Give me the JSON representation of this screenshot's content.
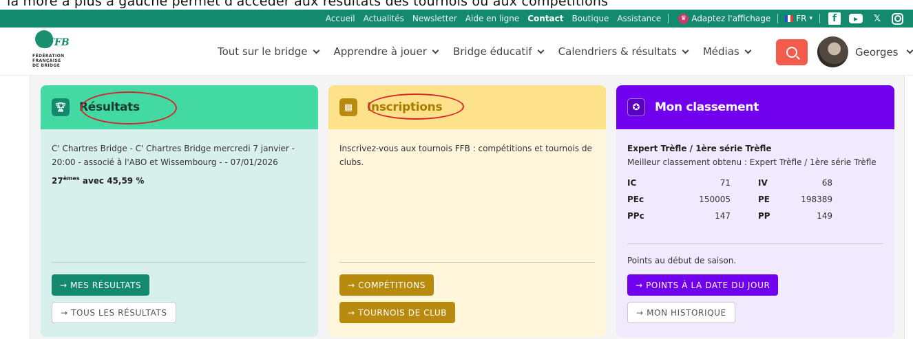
{
  "caption": "la more a plus a gauche permet d'acceder aux resultats des tournois ou aux competitions",
  "topbar": {
    "links": [
      "Accueil",
      "Actualités",
      "Newsletter",
      "Aide en ligne",
      "Contact",
      "Boutique",
      "Assistance"
    ],
    "adapt_label": "Adaptez l'affichage",
    "lang": "FR",
    "social": [
      "facebook-icon",
      "youtube-icon",
      "x-icon",
      "instagram-icon"
    ]
  },
  "logo": {
    "brand": "FFB",
    "line1": "FÉDÉRATION",
    "line2": "FRANÇAISE",
    "line3": "DE BRIDGE"
  },
  "nav": {
    "items": [
      "Tout sur le bridge",
      "Apprendre à jouer",
      "Bridge éducatif",
      "Calendriers & résultats",
      "Médias"
    ],
    "user": "Georges"
  },
  "cards": {
    "results": {
      "title": "Résultats",
      "text": "C' Chartres Bridge - C' Chartres Bridge mercredi 7 janvier - 20:00 - associé à l'ABO et Wissembourg - - 07/01/2026",
      "rank": "27",
      "rank_sup": "èmes",
      "score": "avec 45,59 %",
      "btn_primary": "→ MES RÉSULTATS",
      "btn_secondary": "→ TOUS LES RÉSULTATS"
    },
    "registrations": {
      "title": "Inscriptions",
      "text": "Inscrivez-vous aux tournois FFB : compétitions et tournois de clubs.",
      "btn_primary": "→ COMPÉTITIONS",
      "btn_secondary": "→ TOURNOIS DE CLUB"
    },
    "ranking": {
      "title": "Mon classement",
      "series": "Expert Trèfle / 1ère série Trèfle",
      "best": "Meilleur classement obtenu : Expert Trèfle / 1ère série Trèfle",
      "stats": [
        {
          "k1": "IC",
          "v1": "71",
          "k2": "IV",
          "v2": "68"
        },
        {
          "k1": "PEc",
          "v1": "150005",
          "k2": "PE",
          "v2": "198389"
        },
        {
          "k1": "PPc",
          "v1": "147",
          "k2": "PP",
          "v2": "149"
        }
      ],
      "season": "Points au début de saison.",
      "btn_primary": "→ POINTS À LA DATE DU JOUR",
      "btn_secondary": "→ MON HISTORIQUE"
    }
  },
  "colors": {
    "brand_green": "#138a6e",
    "mint": "#43d9a3",
    "gold": "#b88a0d",
    "purple": "#7000ee",
    "search": "#f25c4d"
  }
}
